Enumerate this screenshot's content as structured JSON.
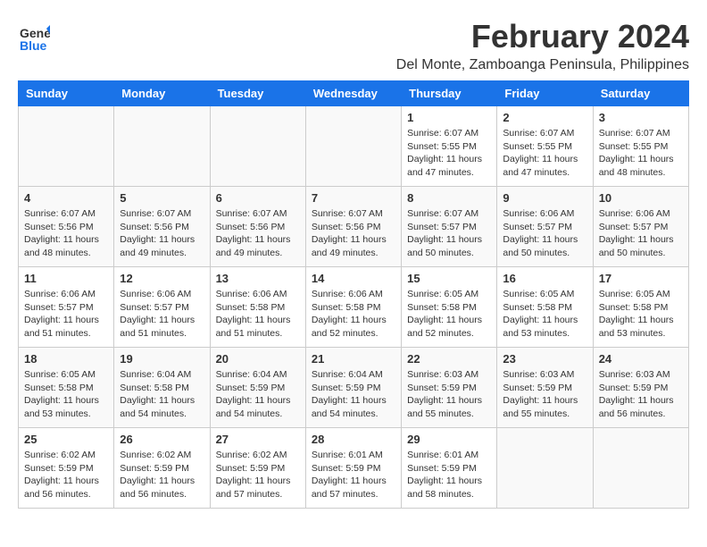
{
  "logo": {
    "line1": "General",
    "line2": "Blue"
  },
  "title": "February 2024",
  "location": "Del Monte, Zamboanga Peninsula, Philippines",
  "weekdays": [
    "Sunday",
    "Monday",
    "Tuesday",
    "Wednesday",
    "Thursday",
    "Friday",
    "Saturday"
  ],
  "weeks": [
    [
      {
        "day": "",
        "sunrise": "",
        "sunset": "",
        "daylight": ""
      },
      {
        "day": "",
        "sunrise": "",
        "sunset": "",
        "daylight": ""
      },
      {
        "day": "",
        "sunrise": "",
        "sunset": "",
        "daylight": ""
      },
      {
        "day": "",
        "sunrise": "",
        "sunset": "",
        "daylight": ""
      },
      {
        "day": "1",
        "sunrise": "Sunrise: 6:07 AM",
        "sunset": "Sunset: 5:55 PM",
        "daylight": "Daylight: 11 hours and 47 minutes."
      },
      {
        "day": "2",
        "sunrise": "Sunrise: 6:07 AM",
        "sunset": "Sunset: 5:55 PM",
        "daylight": "Daylight: 11 hours and 47 minutes."
      },
      {
        "day": "3",
        "sunrise": "Sunrise: 6:07 AM",
        "sunset": "Sunset: 5:55 PM",
        "daylight": "Daylight: 11 hours and 48 minutes."
      }
    ],
    [
      {
        "day": "4",
        "sunrise": "Sunrise: 6:07 AM",
        "sunset": "Sunset: 5:56 PM",
        "daylight": "Daylight: 11 hours and 48 minutes."
      },
      {
        "day": "5",
        "sunrise": "Sunrise: 6:07 AM",
        "sunset": "Sunset: 5:56 PM",
        "daylight": "Daylight: 11 hours and 49 minutes."
      },
      {
        "day": "6",
        "sunrise": "Sunrise: 6:07 AM",
        "sunset": "Sunset: 5:56 PM",
        "daylight": "Daylight: 11 hours and 49 minutes."
      },
      {
        "day": "7",
        "sunrise": "Sunrise: 6:07 AM",
        "sunset": "Sunset: 5:56 PM",
        "daylight": "Daylight: 11 hours and 49 minutes."
      },
      {
        "day": "8",
        "sunrise": "Sunrise: 6:07 AM",
        "sunset": "Sunset: 5:57 PM",
        "daylight": "Daylight: 11 hours and 50 minutes."
      },
      {
        "day": "9",
        "sunrise": "Sunrise: 6:06 AM",
        "sunset": "Sunset: 5:57 PM",
        "daylight": "Daylight: 11 hours and 50 minutes."
      },
      {
        "day": "10",
        "sunrise": "Sunrise: 6:06 AM",
        "sunset": "Sunset: 5:57 PM",
        "daylight": "Daylight: 11 hours and 50 minutes."
      }
    ],
    [
      {
        "day": "11",
        "sunrise": "Sunrise: 6:06 AM",
        "sunset": "Sunset: 5:57 PM",
        "daylight": "Daylight: 11 hours and 51 minutes."
      },
      {
        "day": "12",
        "sunrise": "Sunrise: 6:06 AM",
        "sunset": "Sunset: 5:57 PM",
        "daylight": "Daylight: 11 hours and 51 minutes."
      },
      {
        "day": "13",
        "sunrise": "Sunrise: 6:06 AM",
        "sunset": "Sunset: 5:58 PM",
        "daylight": "Daylight: 11 hours and 51 minutes."
      },
      {
        "day": "14",
        "sunrise": "Sunrise: 6:06 AM",
        "sunset": "Sunset: 5:58 PM",
        "daylight": "Daylight: 11 hours and 52 minutes."
      },
      {
        "day": "15",
        "sunrise": "Sunrise: 6:05 AM",
        "sunset": "Sunset: 5:58 PM",
        "daylight": "Daylight: 11 hours and 52 minutes."
      },
      {
        "day": "16",
        "sunrise": "Sunrise: 6:05 AM",
        "sunset": "Sunset: 5:58 PM",
        "daylight": "Daylight: 11 hours and 53 minutes."
      },
      {
        "day": "17",
        "sunrise": "Sunrise: 6:05 AM",
        "sunset": "Sunset: 5:58 PM",
        "daylight": "Daylight: 11 hours and 53 minutes."
      }
    ],
    [
      {
        "day": "18",
        "sunrise": "Sunrise: 6:05 AM",
        "sunset": "Sunset: 5:58 PM",
        "daylight": "Daylight: 11 hours and 53 minutes."
      },
      {
        "day": "19",
        "sunrise": "Sunrise: 6:04 AM",
        "sunset": "Sunset: 5:58 PM",
        "daylight": "Daylight: 11 hours and 54 minutes."
      },
      {
        "day": "20",
        "sunrise": "Sunrise: 6:04 AM",
        "sunset": "Sunset: 5:59 PM",
        "daylight": "Daylight: 11 hours and 54 minutes."
      },
      {
        "day": "21",
        "sunrise": "Sunrise: 6:04 AM",
        "sunset": "Sunset: 5:59 PM",
        "daylight": "Daylight: 11 hours and 54 minutes."
      },
      {
        "day": "22",
        "sunrise": "Sunrise: 6:03 AM",
        "sunset": "Sunset: 5:59 PM",
        "daylight": "Daylight: 11 hours and 55 minutes."
      },
      {
        "day": "23",
        "sunrise": "Sunrise: 6:03 AM",
        "sunset": "Sunset: 5:59 PM",
        "daylight": "Daylight: 11 hours and 55 minutes."
      },
      {
        "day": "24",
        "sunrise": "Sunrise: 6:03 AM",
        "sunset": "Sunset: 5:59 PM",
        "daylight": "Daylight: 11 hours and 56 minutes."
      }
    ],
    [
      {
        "day": "25",
        "sunrise": "Sunrise: 6:02 AM",
        "sunset": "Sunset: 5:59 PM",
        "daylight": "Daylight: 11 hours and 56 minutes."
      },
      {
        "day": "26",
        "sunrise": "Sunrise: 6:02 AM",
        "sunset": "Sunset: 5:59 PM",
        "daylight": "Daylight: 11 hours and 56 minutes."
      },
      {
        "day": "27",
        "sunrise": "Sunrise: 6:02 AM",
        "sunset": "Sunset: 5:59 PM",
        "daylight": "Daylight: 11 hours and 57 minutes."
      },
      {
        "day": "28",
        "sunrise": "Sunrise: 6:01 AM",
        "sunset": "Sunset: 5:59 PM",
        "daylight": "Daylight: 11 hours and 57 minutes."
      },
      {
        "day": "29",
        "sunrise": "Sunrise: 6:01 AM",
        "sunset": "Sunset: 5:59 PM",
        "daylight": "Daylight: 11 hours and 58 minutes."
      },
      {
        "day": "",
        "sunrise": "",
        "sunset": "",
        "daylight": ""
      },
      {
        "day": "",
        "sunrise": "",
        "sunset": "",
        "daylight": ""
      }
    ]
  ]
}
